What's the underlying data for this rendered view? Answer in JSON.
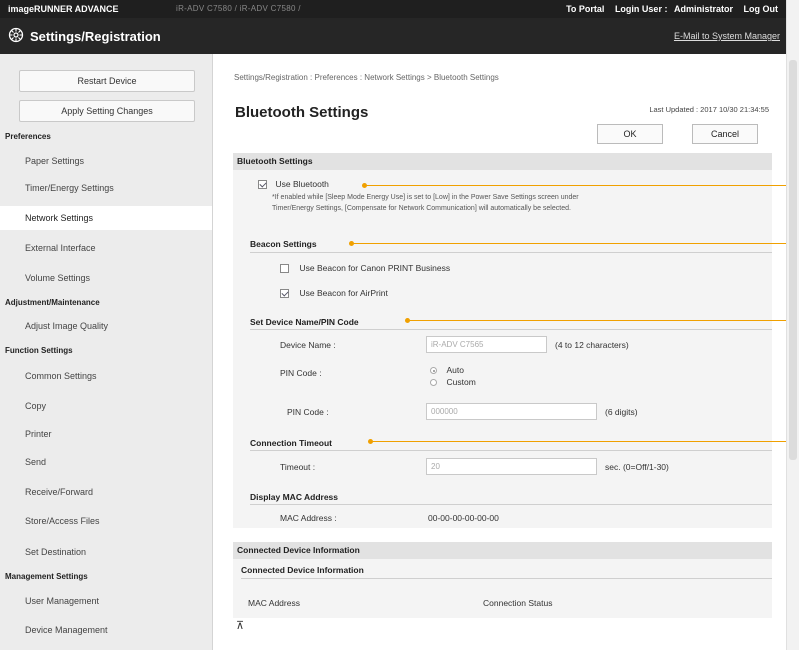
{
  "header": {
    "product": "imageRUNNER ADVANCE",
    "device": "iR-ADV C7580 / iR-ADV C7580 /",
    "portal": "To Portal",
    "login_label": "Login User :",
    "user": "Administrator",
    "logout": "Log Out",
    "title": "Settings/Registration",
    "mail": "E-Mail to System Manager"
  },
  "sidebar": {
    "restart": "Restart Device",
    "apply": "Apply Setting Changes",
    "groups": [
      "Preferences",
      "Adjustment/Maintenance",
      "Function Settings",
      "Management Settings"
    ],
    "items": [
      "Paper Settings",
      "Timer/Energy Settings",
      "Network Settings",
      "External Interface",
      "Volume Settings",
      "Adjust Image Quality",
      "Common Settings",
      "Copy",
      "Printer",
      "Send",
      "Receive/Forward",
      "Store/Access Files",
      "Set Destination",
      "User Management",
      "Device Management"
    ]
  },
  "main": {
    "breadcrumb": "Settings/Registration : Preferences : Network Settings > Bluetooth Settings",
    "title": "Bluetooth Settings",
    "last_updated": "Last Updated : 2017 10/30 21:34:55",
    "ok": "OK",
    "cancel": "Cancel",
    "bt": {
      "heading": "Bluetooth Settings",
      "use_label": "Use Bluetooth",
      "note1": "*If enabled while [Sleep Mode Energy Use] is set to [Low] in the Power Save Settings screen under",
      "note2": "Timer/Energy Settings, [Compensate for Network Communication] will automatically be selected.",
      "beacon_heading": "Beacon Settings",
      "beacon_canon": "Use Beacon for Canon PRINT Business",
      "beacon_airprint": "Use Beacon for AirPrint",
      "device_heading": "Set Device Name/PIN Code",
      "device_name_label": "Device Name :",
      "device_name_value": "iR-ADV C7565",
      "device_name_hint": "(4 to 12 characters)",
      "pin_label": "PIN Code :",
      "pin_auto": "Auto",
      "pin_custom": "Custom",
      "pin_code_label": "PIN Code :",
      "pin_code_value": "000000",
      "pin_hint": "(6 digits)",
      "timeout_heading": "Connection Timeout",
      "timeout_label": "Timeout :",
      "timeout_value": "20",
      "timeout_hint": "sec. (0=Off/1-30)",
      "mac_heading": "Display MAC Address",
      "mac_label": "MAC Address :",
      "mac_value": "00-00-00-00-00-00"
    },
    "connected": {
      "heading": "Connected Device Information",
      "subheading": "Connected Device Information",
      "col_mac": "MAC Address",
      "col_status": "Connection Status"
    },
    "top_glyph": "⊼"
  },
  "colors": {
    "accent": "#f0a000",
    "topbar": "#1f1f1f",
    "sidebar": "#ececec"
  }
}
